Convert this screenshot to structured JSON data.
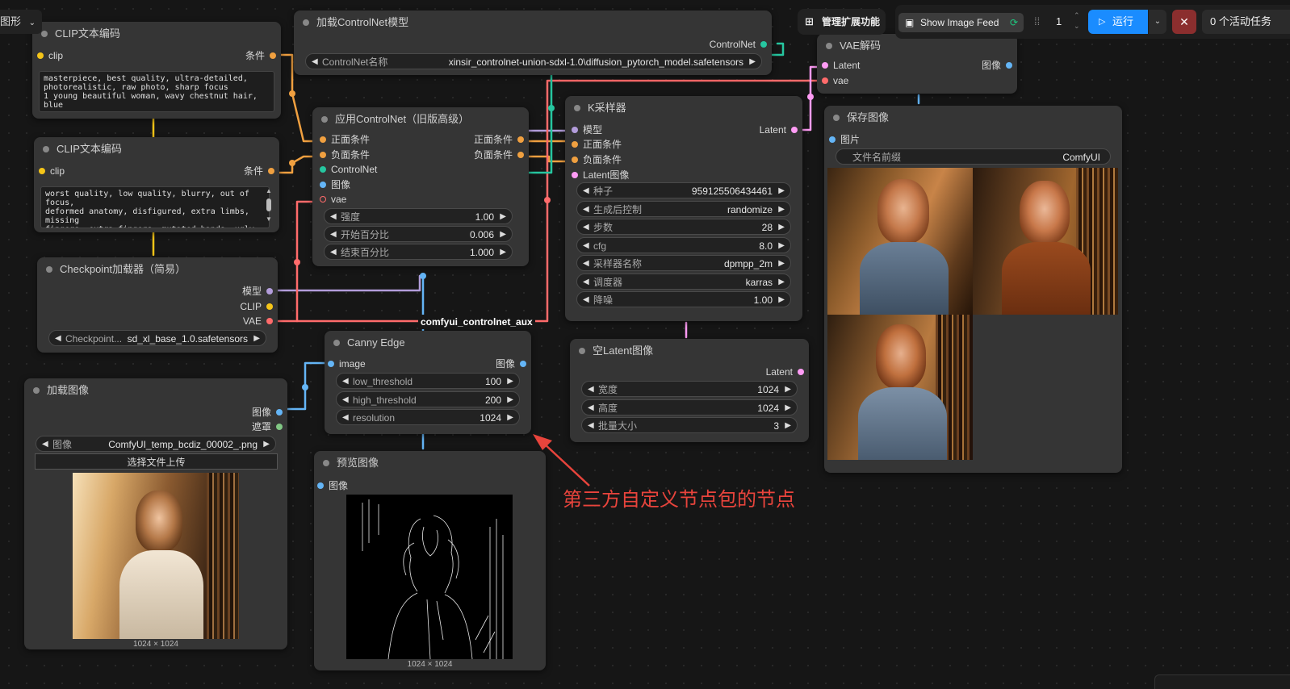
{
  "menu": {
    "label": "图形"
  },
  "toolbar": {
    "manage_extensions": "管理扩展功能",
    "show_image_feed": "Show Image Feed",
    "queue_count": "1",
    "run": "运行",
    "active_tasks": "0 个活动任务"
  },
  "nodes": {
    "clip1": {
      "title": "CLIP文本编码",
      "in_clip": "clip",
      "out_cond": "条件",
      "text": "masterpiece, best quality, ultra-detailed,\nphotorealistic, raw photo, sharp focus\n1 young beautiful woman, wavy chestnut hair, blue\neyes,"
    },
    "clip2": {
      "title": "CLIP文本编码",
      "in_clip": "clip",
      "out_cond": "条件",
      "text": "worst quality, low quality, blurry, out of focus,\ndeformed anatomy, disfigured, extra limbs, missing\nfingers, extra fingers, mutated hands, ugly,\noverexposed, underexposed, watermark, text,\nsignature, cropped, jpeg artifacts, grainy"
    },
    "cnload": {
      "title": "加载ControlNet模型",
      "out": "ControlNet",
      "w_label": "ControlNet名称",
      "w_value": "xinsir_controlnet-union-sdxl-1.0\\diffusion_pytorch_model.safetensors"
    },
    "apply": {
      "title": "应用ControlNet（旧版高级）",
      "in_pos": "正面条件",
      "in_neg": "负面条件",
      "in_cn": "ControlNet",
      "in_img": "图像",
      "in_vae": "vae",
      "out_pos": "正面条件",
      "out_neg": "负面条件",
      "w_strength_l": "强度",
      "w_strength_v": "1.00",
      "w_start_l": "开始百分比",
      "w_start_v": "0.006",
      "w_end_l": "结束百分比",
      "w_end_v": "1.000"
    },
    "ksampler": {
      "title": "K采样器",
      "in_model": "模型",
      "in_pos": "正面条件",
      "in_neg": "负面条件",
      "in_latent": "Latent图像",
      "out": "Latent",
      "seed_l": "种子",
      "seed_v": "959125506434461",
      "ctrl_l": "生成后控制",
      "ctrl_v": "randomize",
      "steps_l": "步数",
      "steps_v": "28",
      "cfg_l": "cfg",
      "cfg_v": "8.0",
      "sampler_l": "采样器名称",
      "sampler_v": "dpmpp_2m",
      "sched_l": "调度器",
      "sched_v": "karras",
      "denoise_l": "降噪",
      "denoise_v": "1.00"
    },
    "vae": {
      "title": "VAE解码",
      "in_latent": "Latent",
      "in_vae": "vae",
      "out": "图像"
    },
    "save": {
      "title": "保存图像",
      "in_img": "图片",
      "prefix_l": "文件名前缀",
      "prefix_v": "ComfyUI"
    },
    "ckpt": {
      "title": "Checkpoint加载器（简易）",
      "out_model": "模型",
      "out_clip": "CLIP",
      "out_vae": "VAE",
      "w_label": "Checkpoint...",
      "w_value": "sd_xl_base_1.0.safetensors"
    },
    "canny": {
      "title": "Canny Edge",
      "in_img": "image",
      "out": "图像",
      "low_l": "low_threshold",
      "low_v": "100",
      "high_l": "high_threshold",
      "high_v": "200",
      "res_l": "resolution",
      "res_v": "1024"
    },
    "empty": {
      "title": "空Latent图像",
      "out": "Latent",
      "w_l": "宽度",
      "w_v": "1024",
      "h_l": "高度",
      "h_v": "1024",
      "b_l": "批量大小",
      "b_v": "3"
    },
    "loadimg": {
      "title": "加载图像",
      "out_img": "图像",
      "out_mask": "遮罩",
      "w_label": "图像",
      "w_value": "ComfyUI_temp_bcdiz_00002_.png",
      "upload": "选择文件上传",
      "caption": "1024 × 1024"
    },
    "preview": {
      "title": "预览图像",
      "in_img": "图像",
      "caption": "1024 × 1024"
    }
  },
  "group_label": "comfyui_controlnet_aux",
  "annotation": "第三方自定义节点包的节点",
  "colors": {
    "clip": "#f5c518",
    "cond": "#f0a040",
    "model": "#b39ddb",
    "vae": "#ff6b6b",
    "image": "#64b5f6",
    "latent": "#ff9cf5",
    "controlnet": "#26c6a0",
    "mask": "#81c784",
    "run": "#1a8cff",
    "annotation": "#e8443c"
  }
}
